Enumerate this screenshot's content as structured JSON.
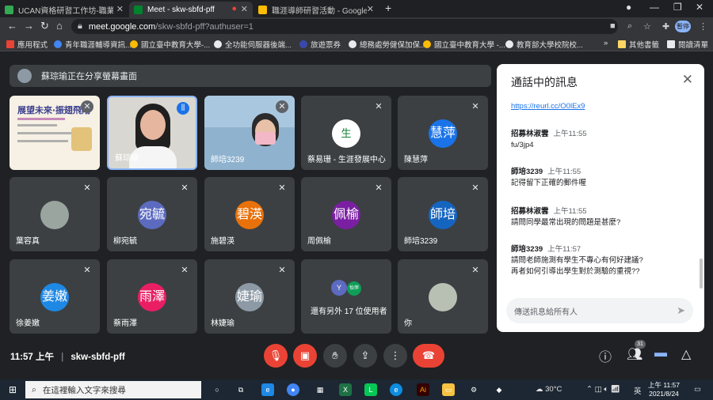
{
  "browser": {
    "tabs": [
      {
        "label": "UCAN資格研習工作坊-職業興趣",
        "active": false
      },
      {
        "label": "Meet - skw-sbfd-pff",
        "active": true
      },
      {
        "label": "職涯導師研習活動 - Google 雲端",
        "active": false
      }
    ],
    "url_host": "meet.google.com",
    "url_path": "/skw-sbfd-pff?authuser=1",
    "profile_label": "暫停",
    "bookmarks": [
      "應用程式",
      "青年職涯輔導資訊...",
      "國立臺中教育大學-...",
      "全功能伺服器後端...",
      "旅遊票券",
      "總務處勞健保加保...",
      "國立臺中教育大學 -...",
      "教育部大學校院校...",
      "其他書籤",
      "閱讀清單"
    ]
  },
  "meet": {
    "presenting_banner": "蘇琮瑜正在分享螢幕畫面",
    "participants": [
      {
        "name": "",
        "initial": "",
        "slide_title": "展望未來‧振翅飛翔"
      },
      {
        "name": "蘇琮瑜",
        "initial": ""
      },
      {
        "name": "師培3239",
        "initial": ""
      },
      {
        "name": "蔡易珊 - 生涯發展中心",
        "initial": "生"
      },
      {
        "name": "陳慧萍",
        "initial": "慧萍",
        "color": "#1a73e8"
      },
      {
        "name": "葉容真",
        "initial": "",
        "color": "#8d9aa5"
      },
      {
        "name": "柳宛毓",
        "initial": "宛毓",
        "color": "#5c6bc0"
      },
      {
        "name": "施碧渶",
        "initial": "碧渶",
        "color": "#e8710a"
      },
      {
        "name": "周佩榆",
        "initial": "佩榆",
        "color": "#7b1fa2"
      },
      {
        "name": "師培3239",
        "initial": "師培",
        "color": "#1565c0"
      },
      {
        "name": "徐姜嫩",
        "initial": "姜嫩",
        "color": "#1e88e5"
      },
      {
        "name": "蔡雨澤",
        "initial": "雨澤",
        "color": "#e91e63"
      },
      {
        "name": "林婕瑜",
        "initial": "婕瑜",
        "color": "#8d9aa5"
      },
      {
        "name": "還有另外 17 位使用者",
        "initial": "Y",
        "color": "#5c6bc0",
        "second_initial": "怡萍"
      },
      {
        "name": "你",
        "initial": "",
        "color": "#8d9aa5"
      }
    ],
    "meeting_time": "11:57 上午",
    "meeting_code": "skw-sbfd-pff",
    "people_count": "31"
  },
  "chat": {
    "title": "通話中的訊息",
    "messages": [
      {
        "sender": "",
        "time": "",
        "text": "https://reurl.cc/O0lEx9",
        "link": true
      },
      {
        "sender": "招募林淑雲",
        "time": "上午11:55",
        "text": "fu/3jp4"
      },
      {
        "sender": "師培3239",
        "time": "上午11:55",
        "text": "記得留下正確的郵件喔"
      },
      {
        "sender": "招募林淑雲",
        "time": "上午11:55",
        "text": "請問同學最常出現的問題是甚麼?"
      },
      {
        "sender": "師培3239",
        "time": "上午11:57",
        "text": "請問老師施測有學生不專心有何好建議?",
        "text2": "再者如何引導出學生對於測驗的重視??"
      }
    ],
    "input_placeholder": "傳送訊息給所有人"
  },
  "taskbar": {
    "search_placeholder": "在這裡輸入文字來搜尋",
    "weather": "30°C",
    "ime": "英",
    "clock_time": "上午 11:57",
    "clock_date": "2021/8/24"
  }
}
